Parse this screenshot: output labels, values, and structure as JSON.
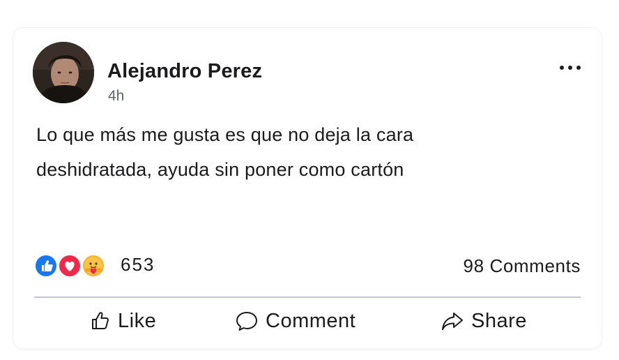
{
  "post": {
    "author": "Alejandro Perez",
    "timestamp": "4h",
    "text_line1": "Lo que más me gusta es que no deja la cara",
    "text_line2": "deshidratada, ayuda sin poner como cartón",
    "reactions": [
      "like-icon",
      "love-icon",
      "care-icon"
    ],
    "reaction_count": "653",
    "comments_count": "98 Comments"
  },
  "actions": {
    "like": "Like",
    "comment": "Comment",
    "share": "Share"
  },
  "colors": {
    "like": "#1877f2",
    "love": "#f0284a",
    "care": "#f7b125",
    "divider": "#bfc6d4"
  }
}
